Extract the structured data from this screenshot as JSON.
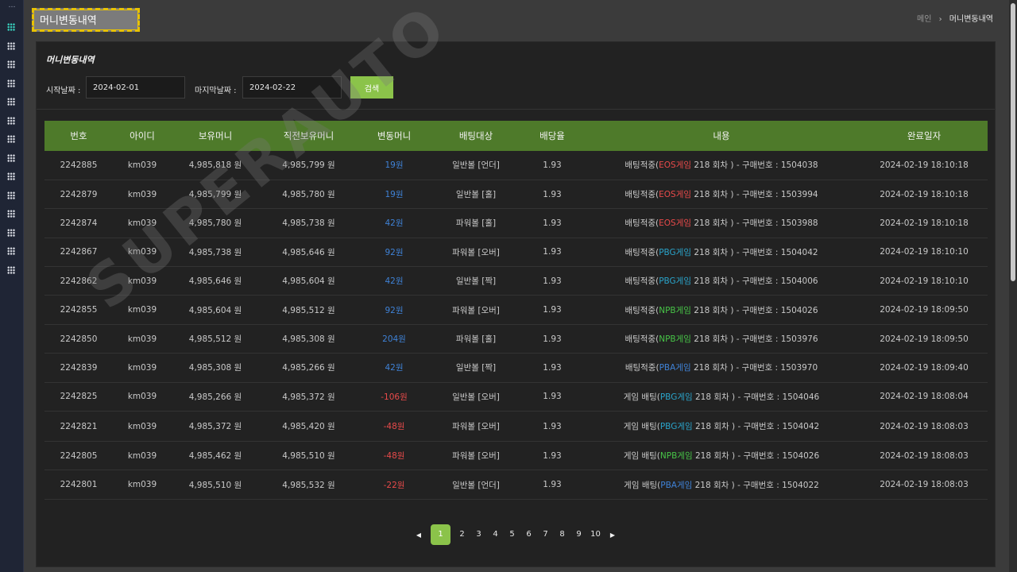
{
  "sidebar": {
    "top": "…",
    "icons": 14,
    "active_index": 0
  },
  "page_title": "머니변동내역",
  "breadcrumb": {
    "home": "메인",
    "separator": "›",
    "current": "머니변동내역"
  },
  "panel": {
    "title": "머니변동내역",
    "filter": {
      "start_label": "시작날짜 :",
      "start_value": "2024-02-01",
      "end_label": "마지막날짜 :",
      "end_value": "2024-02-22",
      "search_label": "검색"
    }
  },
  "table": {
    "headers": [
      "번호",
      "아이디",
      "보유머니",
      "직전보유머니",
      "변동머니",
      "배팅대상",
      "배당율",
      "내용",
      "완료일자"
    ],
    "rows": [
      {
        "no": "2242885",
        "id": "km039",
        "balance": "4,985,818 원",
        "prev": "4,985,799 원",
        "change": "19원",
        "sign": "pos",
        "target": "일반볼 [언더]",
        "odds": "1.93",
        "c_pre": "배팅적중(",
        "game": "EOS게임",
        "game_color": "red",
        "c_post": "218 회차 ) - 구매번호 : 1504038",
        "date": "2024-02-19 18:10:18"
      },
      {
        "no": "2242879",
        "id": "km039",
        "balance": "4,985,799 원",
        "prev": "4,985,780 원",
        "change": "19원",
        "sign": "pos",
        "target": "일반볼 [홀]",
        "odds": "1.93",
        "c_pre": "배팅적중(",
        "game": "EOS게임",
        "game_color": "red",
        "c_post": "218 회차 ) - 구매번호 : 1503994",
        "date": "2024-02-19 18:10:18"
      },
      {
        "no": "2242874",
        "id": "km039",
        "balance": "4,985,780 원",
        "prev": "4,985,738 원",
        "change": "42원",
        "sign": "pos",
        "target": "파워볼 [홀]",
        "odds": "1.93",
        "c_pre": "배팅적중(",
        "game": "EOS게임",
        "game_color": "red",
        "c_post": "218 회차 ) - 구매번호 : 1503988",
        "date": "2024-02-19 18:10:18"
      },
      {
        "no": "2242867",
        "id": "km039",
        "balance": "4,985,738 원",
        "prev": "4,985,646 원",
        "change": "92원",
        "sign": "pos",
        "target": "파워볼 [오버]",
        "odds": "1.93",
        "c_pre": "배팅적중(",
        "game": "PBG게임",
        "game_color": "cyan",
        "c_post": "218 회차 ) - 구매번호 : 1504042",
        "date": "2024-02-19 18:10:10"
      },
      {
        "no": "2242862",
        "id": "km039",
        "balance": "4,985,646 원",
        "prev": "4,985,604 원",
        "change": "42원",
        "sign": "pos",
        "target": "일반볼 [짝]",
        "odds": "1.93",
        "c_pre": "배팅적중(",
        "game": "PBG게임",
        "game_color": "cyan",
        "c_post": "218 회차 ) - 구매번호 : 1504006",
        "date": "2024-02-19 18:10:10"
      },
      {
        "no": "2242855",
        "id": "km039",
        "balance": "4,985,604 원",
        "prev": "4,985,512 원",
        "change": "92원",
        "sign": "pos",
        "target": "파워볼 [오버]",
        "odds": "1.93",
        "c_pre": "배팅적중(",
        "game": "NPB게임",
        "game_color": "green",
        "c_post": "218 회차 ) - 구매번호 : 1504026",
        "date": "2024-02-19 18:09:50"
      },
      {
        "no": "2242850",
        "id": "km039",
        "balance": "4,985,512 원",
        "prev": "4,985,308 원",
        "change": "204원",
        "sign": "pos",
        "target": "파워볼 [홀]",
        "odds": "1.93",
        "c_pre": "배팅적중(",
        "game": "NPB게임",
        "game_color": "green",
        "c_post": "218 회차 ) - 구매번호 : 1503976",
        "date": "2024-02-19 18:09:50"
      },
      {
        "no": "2242839",
        "id": "km039",
        "balance": "4,985,308 원",
        "prev": "4,985,266 원",
        "change": "42원",
        "sign": "pos",
        "target": "일반볼 [짝]",
        "odds": "1.93",
        "c_pre": "배팅적중(",
        "game": "PBA게임",
        "game_color": "blue",
        "c_post": "218 회차 ) - 구매번호 : 1503970",
        "date": "2024-02-19 18:09:40"
      },
      {
        "no": "2242825",
        "id": "km039",
        "balance": "4,985,266 원",
        "prev": "4,985,372 원",
        "change": "-106원",
        "sign": "neg",
        "target": "일반볼 [오버]",
        "odds": "1.93",
        "c_pre": "게임 배팅(",
        "game": "PBG게임",
        "game_color": "cyan",
        "c_post": "218 회차 ) - 구매번호 : 1504046",
        "date": "2024-02-19 18:08:04"
      },
      {
        "no": "2242821",
        "id": "km039",
        "balance": "4,985,372 원",
        "prev": "4,985,420 원",
        "change": "-48원",
        "sign": "neg",
        "target": "파워볼 [오버]",
        "odds": "1.93",
        "c_pre": "게임 배팅(",
        "game": "PBG게임",
        "game_color": "cyan",
        "c_post": "218 회차 ) - 구매번호 : 1504042",
        "date": "2024-02-19 18:08:03"
      },
      {
        "no": "2242805",
        "id": "km039",
        "balance": "4,985,462 원",
        "prev": "4,985,510 원",
        "change": "-48원",
        "sign": "neg",
        "target": "파워볼 [오버]",
        "odds": "1.93",
        "c_pre": "게임 배팅(",
        "game": "NPB게임",
        "game_color": "green",
        "c_post": "218 회차 ) - 구매번호 : 1504026",
        "date": "2024-02-19 18:08:03"
      },
      {
        "no": "2242801",
        "id": "km039",
        "balance": "4,985,510 원",
        "prev": "4,985,532 원",
        "change": "-22원",
        "sign": "neg",
        "target": "일반볼 [언더]",
        "odds": "1.93",
        "c_pre": "게임 배팅(",
        "game": "PBA게임",
        "game_color": "blue",
        "c_post": "218 회차 ) - 구매번호 : 1504022",
        "date": "2024-02-19 18:08:03"
      }
    ]
  },
  "pagination": {
    "prev": "◀",
    "next": "▶",
    "pages": [
      "1",
      "2",
      "3",
      "4",
      "5",
      "6",
      "7",
      "8",
      "9",
      "10"
    ],
    "current": "1"
  },
  "watermark": "SUPERAUTO",
  "colors": {
    "accent": "#8bc34a",
    "header": "#4e7a2a",
    "positive": "#3f82d6",
    "negative": "#e84a4a"
  }
}
